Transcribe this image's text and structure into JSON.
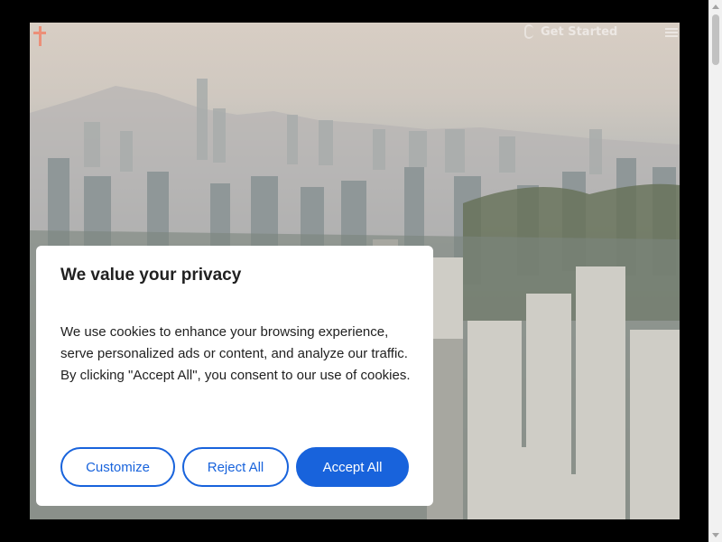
{
  "site_header": {
    "cta_label": "Get Started"
  },
  "cookie_banner": {
    "title": "We value your privacy",
    "body": "We use cookies to enhance your browsing experience, serve personalized ads or content, and analyze our traffic. By clicking \"Accept All\", you consent to our use of cookies.",
    "customize_label": "Customize",
    "reject_label": "Reject All",
    "accept_label": "Accept All"
  },
  "colors": {
    "accent": "#1863dc",
    "logo": "#ec8f78",
    "page_bg": "#000000"
  }
}
